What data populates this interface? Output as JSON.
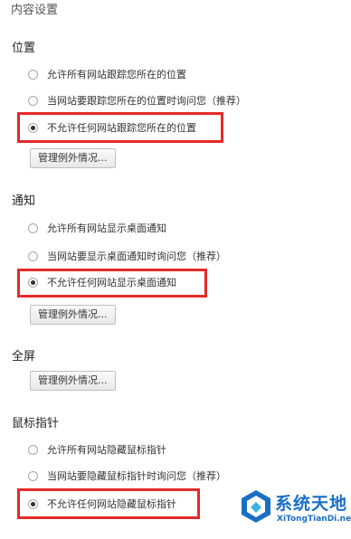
{
  "page_title": "内容设置",
  "location": {
    "title": "位置",
    "options": [
      "允许所有网站跟踪您所在的位置",
      "当网站要跟踪您所在的位置时询问您（推荐）",
      "不允许任何网站跟踪您所在的位置"
    ],
    "selected_index": 2,
    "manage_button": "管理例外情况..."
  },
  "notifications": {
    "title": "通知",
    "options": [
      "允许所有网站显示桌面通知",
      "当网站要显示桌面通知时询问您（推荐）",
      "不允许任何网站显示桌面通知"
    ],
    "selected_index": 2,
    "manage_button": "管理例外情况..."
  },
  "fullscreen": {
    "title": "全屏",
    "manage_button": "管理例外情况..."
  },
  "mouse_pointer": {
    "title": "鼠标指针",
    "options": [
      "允许所有网站隐藏鼠标指针",
      "当网站要隐藏鼠标指针时询问您（推荐）",
      "不允许任何网站隐藏鼠标指针"
    ],
    "selected_index": 2
  },
  "highlight_color": "#e52a2a",
  "watermark": {
    "title": "系统天地",
    "subtitle": "XiTongTianDi.net",
    "color": "#1a6fc4"
  }
}
